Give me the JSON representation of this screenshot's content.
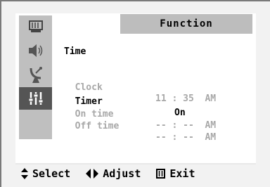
{
  "menu": {
    "header_title": "Function",
    "section_title": "Time",
    "rows": [
      {
        "label": "Clock",
        "value": "11 : 35  AM"
      },
      {
        "label": "Timer",
        "value": "On"
      },
      {
        "label": "On time",
        "value": "-- : --  AM"
      },
      {
        "label": "Off time",
        "value": "-- : --  AM"
      }
    ],
    "sidebar_icons": [
      "picture-icon",
      "sound-icon",
      "channel-antenna-icon",
      "function-settings-icon"
    ]
  },
  "help_bar": {
    "select_label": "Select",
    "adjust_label": "Adjust",
    "exit_label": "Exit"
  },
  "colors": {
    "sidebar": "#bfbfbf",
    "sidebar_active": "#555555",
    "header": "#bdbdbd",
    "dim_text": "#a8a8a8"
  }
}
